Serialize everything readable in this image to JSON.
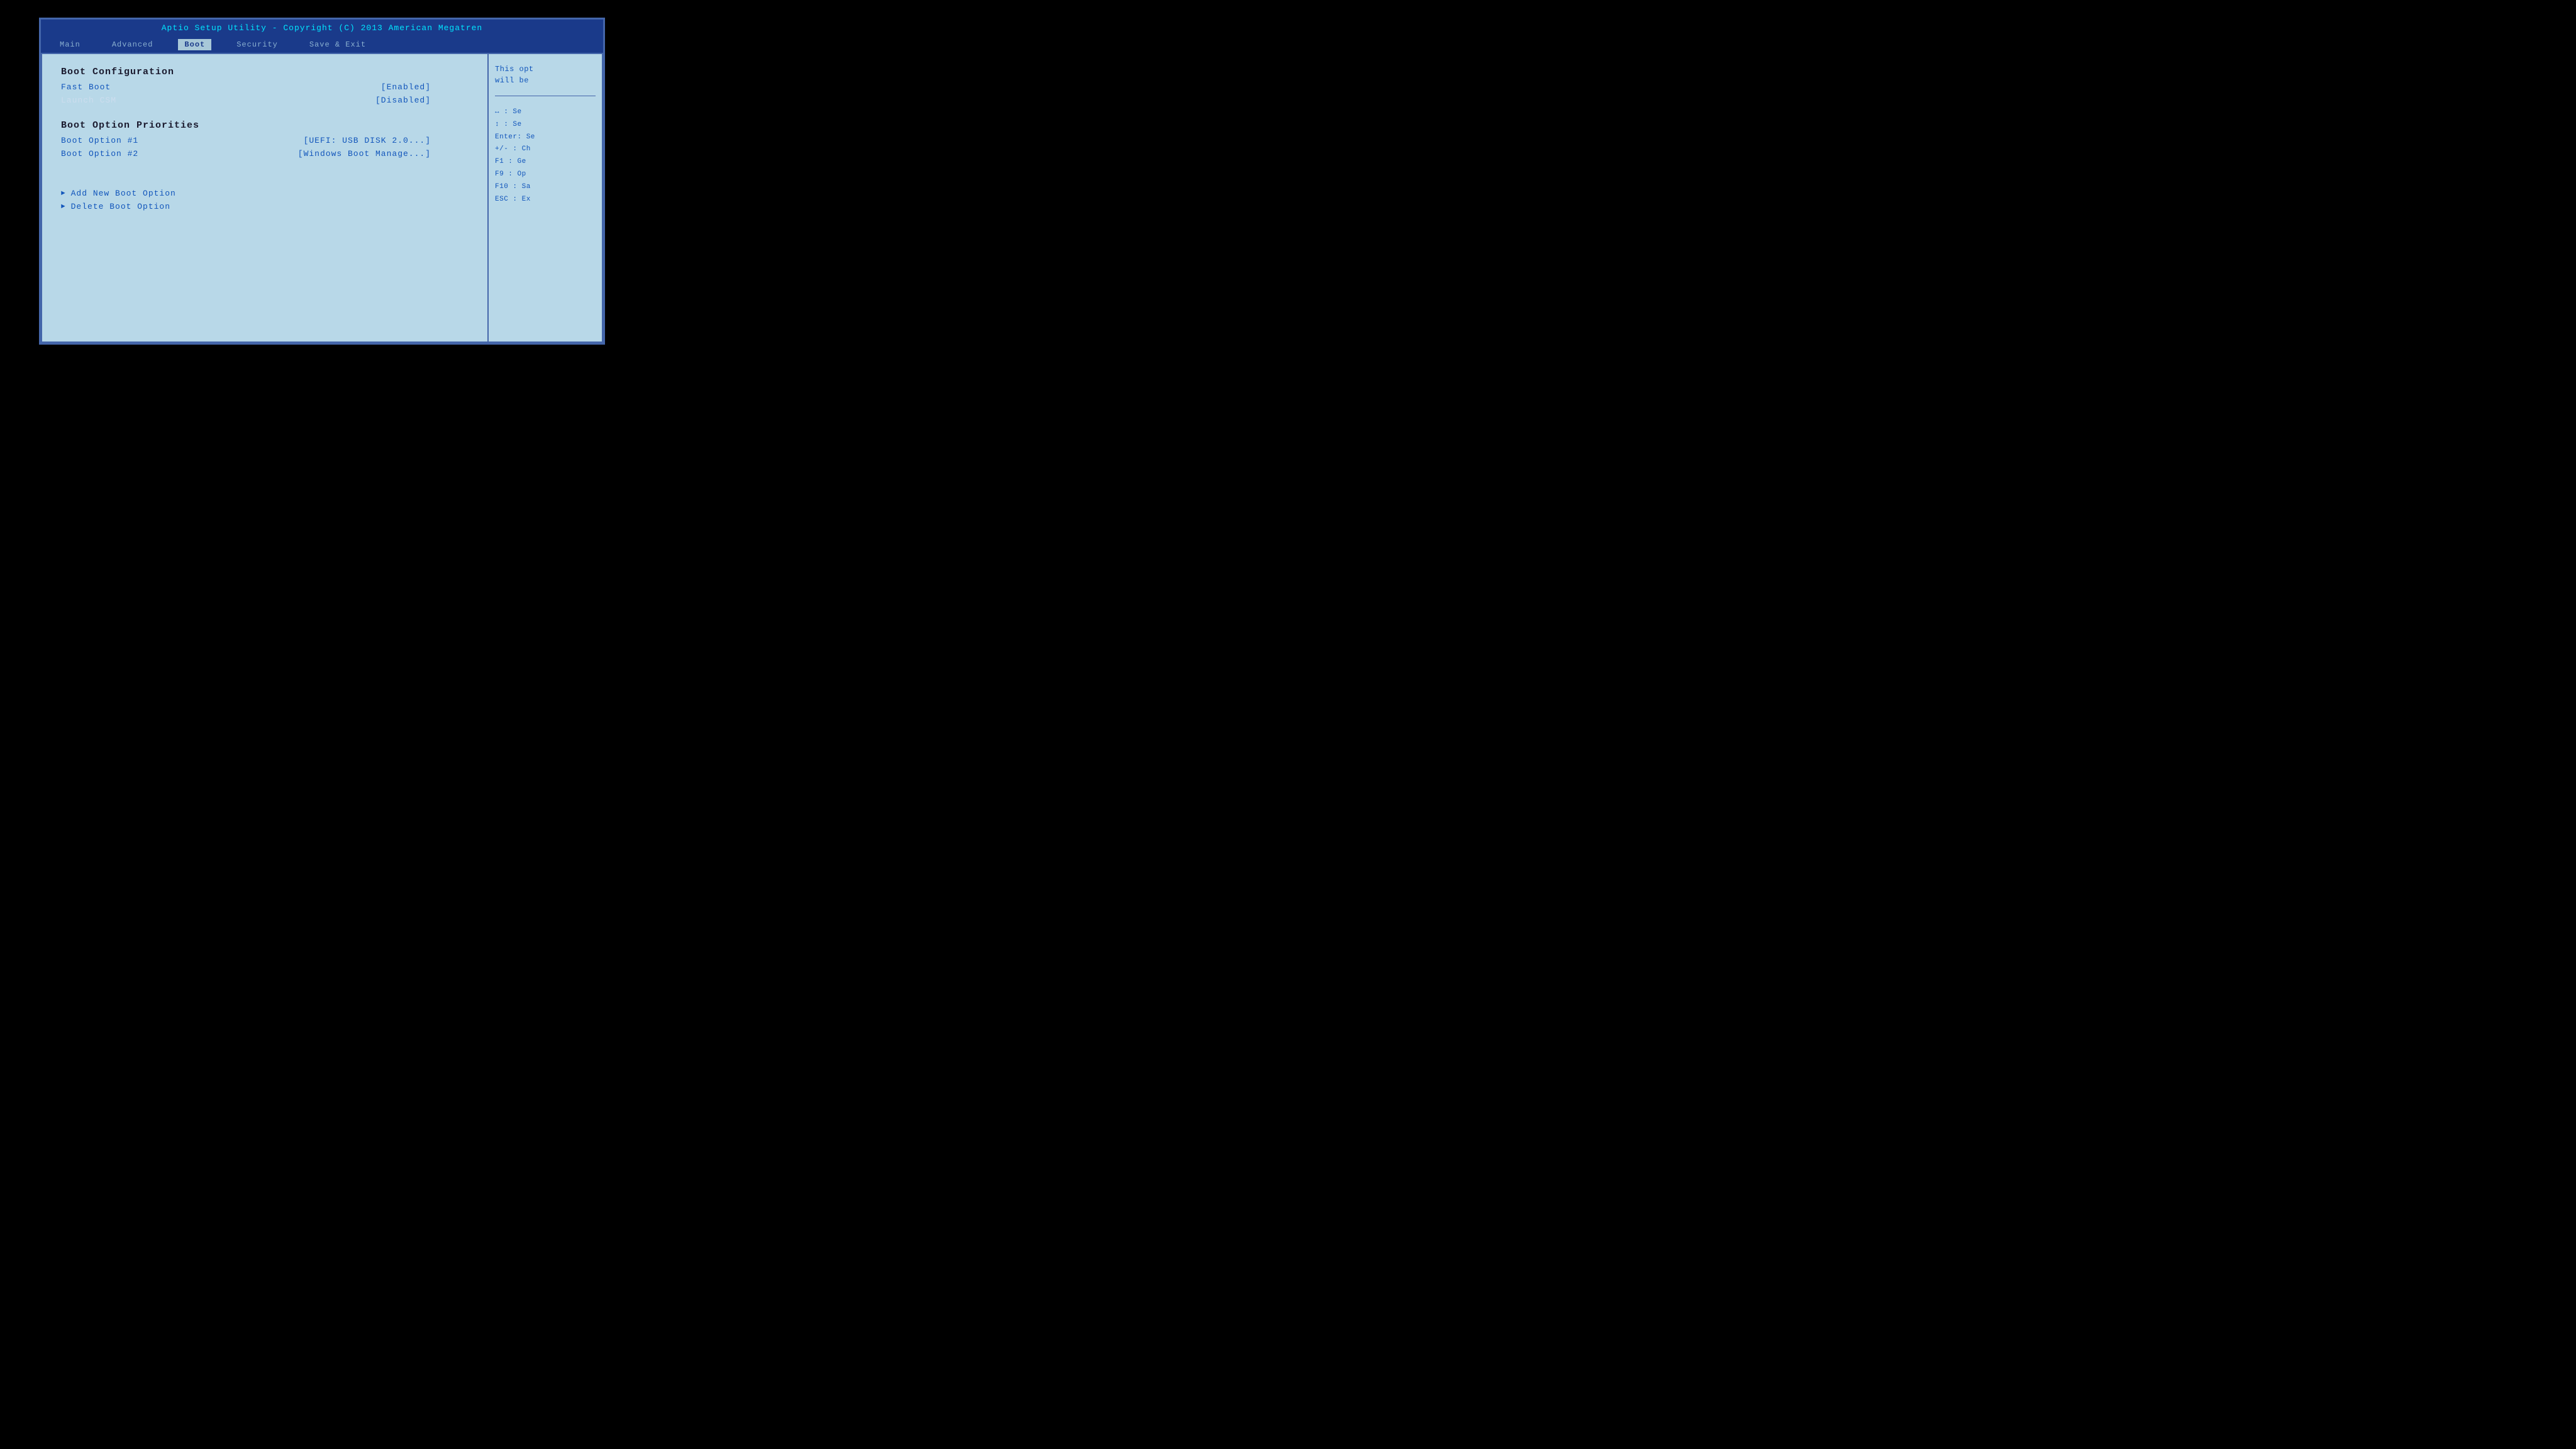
{
  "title_bar": {
    "text": "Aptio Setup Utility - Copyright (C) 2013 American Megatren"
  },
  "nav": {
    "items": [
      {
        "label": "Main",
        "active": false
      },
      {
        "label": "Advanced",
        "active": false
      },
      {
        "label": "Boot",
        "active": true
      },
      {
        "label": "Security",
        "active": false
      },
      {
        "label": "Save & Exit",
        "active": false
      }
    ]
  },
  "main": {
    "boot_config_header": "Boot Configuration",
    "fast_boot_label": "Fast Boot",
    "fast_boot_value": "[Enabled]",
    "launch_csm_label": "Launch CSM",
    "launch_csm_value": "[Disabled]",
    "boot_priorities_header": "Boot Option Priorities",
    "boot_option_1_label": "Boot Option #1",
    "boot_option_1_value": "[UEFI:  USB DISK 2.0...]",
    "boot_option_2_label": "Boot Option #2",
    "boot_option_2_value": "[Windows Boot Manage...]",
    "add_new_boot": "Add New Boot Option",
    "delete_boot": "Delete Boot Option"
  },
  "help": {
    "description_line1": "This opt",
    "description_line2": "will be",
    "keys": [
      {
        "key": "←→",
        "action": "Se"
      },
      {
        "key": "↑↓",
        "action": "Se"
      },
      {
        "key": "Enter:",
        "action": "Se"
      },
      {
        "key": "+/-",
        "action": "Ch"
      },
      {
        "key": "F1",
        "action": "Ge"
      },
      {
        "key": "F9",
        "action": "Op"
      },
      {
        "key": "F10",
        "action": "Sa"
      },
      {
        "key": "ESC",
        "action": "Ex"
      }
    ]
  }
}
